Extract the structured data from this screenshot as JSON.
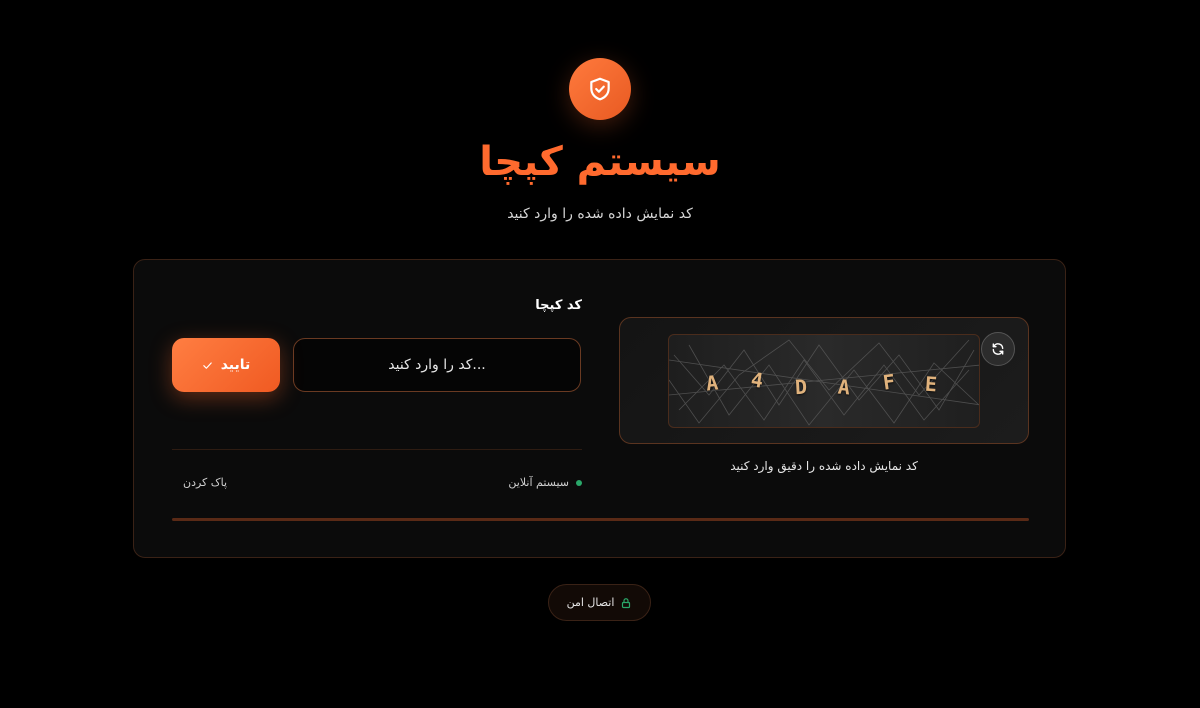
{
  "header": {
    "icon": "shield-check-icon",
    "title": "سیستم کپچا",
    "subtitle": "کد نمایش داده شده را وارد کنید"
  },
  "captcha": {
    "characters": [
      "A",
      "4",
      "D",
      "A",
      "F",
      "E"
    ],
    "refresh_icon": "refresh-icon",
    "hint": "کد نمایش داده شده را دقیق وارد کنید"
  },
  "form": {
    "label": "کد کپچا",
    "input_value": "",
    "input_placeholder": "...کد را وارد کنید",
    "verify_label": "تایید",
    "verify_icon": "check-icon",
    "status_text": "سیستم آنلاین",
    "clear_label": "پاک کردن",
    "progress": 1.0
  },
  "footer": {
    "secure_label": "اتصال امن",
    "secure_icon": "lock-icon"
  },
  "colors": {
    "accent": "#ff6a2e",
    "background": "#000000",
    "card": "#0b0b0b",
    "status_online": "#2aa86a",
    "secure_lock": "#2aa86a"
  }
}
